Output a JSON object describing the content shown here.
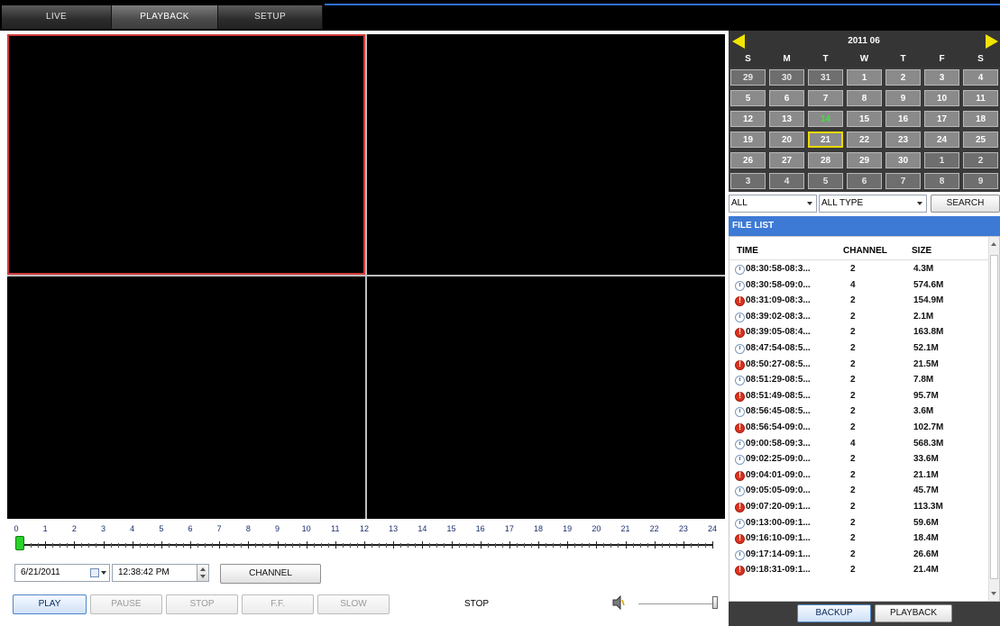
{
  "tabs": [
    {
      "label": "LIVE"
    },
    {
      "label": "PLAYBACK"
    },
    {
      "label": "SETUP"
    }
  ],
  "timeline": {
    "hours": [
      "0",
      "1",
      "2",
      "3",
      "4",
      "5",
      "6",
      "7",
      "8",
      "9",
      "10",
      "11",
      "12",
      "13",
      "14",
      "15",
      "16",
      "17",
      "18",
      "19",
      "20",
      "21",
      "22",
      "23",
      "24"
    ],
    "position_hour": 0
  },
  "controls": {
    "date": "6/21/2011",
    "time": "12:38:42 PM",
    "channel_label": "CHANNEL",
    "play_label": "PLAY",
    "pause_label": "PAUSE",
    "stop_label": "STOP",
    "ff_label": "F.F.",
    "slow_label": "SLOW",
    "status": "STOP"
  },
  "calendar": {
    "title": "2011 06",
    "weekdays": [
      "S",
      "M",
      "T",
      "W",
      "T",
      "F",
      "S"
    ],
    "days": [
      [
        "29",
        "30",
        "31",
        "1",
        "2",
        "3",
        "4"
      ],
      [
        "5",
        "6",
        "7",
        "8",
        "9",
        "10",
        "11"
      ],
      [
        "12",
        "13",
        "14",
        "15",
        "16",
        "17",
        "18"
      ],
      [
        "19",
        "20",
        "21",
        "22",
        "23",
        "24",
        "25"
      ],
      [
        "26",
        "27",
        "28",
        "29",
        "30",
        "1",
        "2"
      ],
      [
        "3",
        "4",
        "5",
        "6",
        "7",
        "8",
        "9"
      ]
    ],
    "today": "14",
    "selected": "21"
  },
  "filters": {
    "channel": "ALL",
    "type": "ALL TYPE",
    "search_label": "SEARCH"
  },
  "file_list": {
    "title": "FILE LIST",
    "columns": [
      "TIME",
      "CHANNEL",
      "SIZE"
    ],
    "rows": [
      {
        "time": "08:30:58-08:3...",
        "channel": "2",
        "size": "4.3M",
        "type": "normal"
      },
      {
        "time": "08:30:58-09:0...",
        "channel": "4",
        "size": "574.6M",
        "type": "normal"
      },
      {
        "time": "08:31:09-08:3...",
        "channel": "2",
        "size": "154.9M",
        "type": "alarm"
      },
      {
        "time": "08:39:02-08:3...",
        "channel": "2",
        "size": "2.1M",
        "type": "normal"
      },
      {
        "time": "08:39:05-08:4...",
        "channel": "2",
        "size": "163.8M",
        "type": "alarm"
      },
      {
        "time": "08:47:54-08:5...",
        "channel": "2",
        "size": "52.1M",
        "type": "normal"
      },
      {
        "time": "08:50:27-08:5...",
        "channel": "2",
        "size": "21.5M",
        "type": "alarm"
      },
      {
        "time": "08:51:29-08:5...",
        "channel": "2",
        "size": "7.8M",
        "type": "normal"
      },
      {
        "time": "08:51:49-08:5...",
        "channel": "2",
        "size": "95.7M",
        "type": "alarm"
      },
      {
        "time": "08:56:45-08:5...",
        "channel": "2",
        "size": "3.6M",
        "type": "normal"
      },
      {
        "time": "08:56:54-09:0...",
        "channel": "2",
        "size": "102.7M",
        "type": "alarm"
      },
      {
        "time": "09:00:58-09:3...",
        "channel": "4",
        "size": "568.3M",
        "type": "normal"
      },
      {
        "time": "09:02:25-09:0...",
        "channel": "2",
        "size": "33.6M",
        "type": "normal"
      },
      {
        "time": "09:04:01-09:0...",
        "channel": "2",
        "size": "21.1M",
        "type": "alarm"
      },
      {
        "time": "09:05:05-09:0...",
        "channel": "2",
        "size": "45.7M",
        "type": "normal"
      },
      {
        "time": "09:07:20-09:1...",
        "channel": "2",
        "size": "113.3M",
        "type": "alarm"
      },
      {
        "time": "09:13:00-09:1...",
        "channel": "2",
        "size": "59.6M",
        "type": "normal"
      },
      {
        "time": "09:16:10-09:1...",
        "channel": "2",
        "size": "18.4M",
        "type": "alarm"
      },
      {
        "time": "09:17:14-09:1...",
        "channel": "2",
        "size": "26.6M",
        "type": "normal"
      },
      {
        "time": "09:18:31-09:1...",
        "channel": "2",
        "size": "21.4M",
        "type": "alarm"
      }
    ]
  },
  "bottom": {
    "backup_label": "BACKUP",
    "playback_label": "PLAYBACK"
  },
  "icons": {
    "normal_record": "clock-record-icon",
    "alarm_record": "alarm-record-icon",
    "speaker": "speaker-icon"
  },
  "colors": {
    "selected_cell_border": "#d23a3a",
    "file_list_header": "#3d7ad6",
    "calendar_nav": "#f2e400",
    "today": "#3ee23e",
    "timeline_handle": "#2bd12b"
  }
}
